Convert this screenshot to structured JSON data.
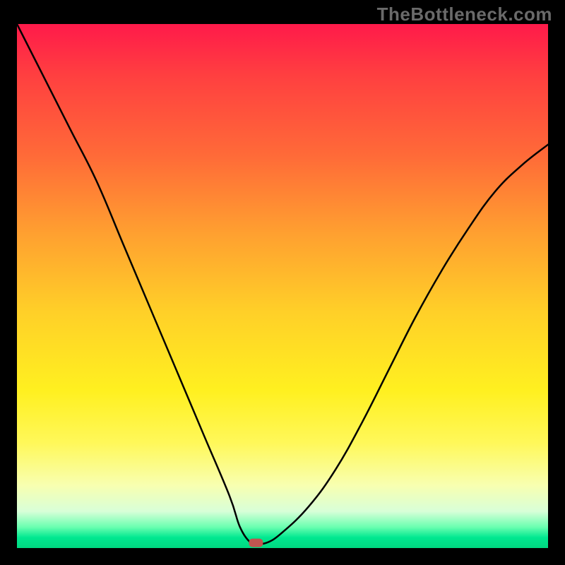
{
  "watermark": "TheBottleneck.com",
  "chart_data": {
    "type": "line",
    "title": "",
    "xlabel": "",
    "ylabel": "",
    "xlim": [
      0,
      100
    ],
    "ylim": [
      0,
      100
    ],
    "series": [
      {
        "name": "bottleneck-curve",
        "x": [
          0,
          5,
          10,
          15,
          20,
          25,
          30,
          35,
          40,
          42,
          44,
          45,
          47,
          50,
          55,
          60,
          65,
          70,
          75,
          80,
          85,
          90,
          95,
          100
        ],
        "y": [
          100,
          90,
          80,
          70,
          58,
          46,
          34,
          22,
          10,
          4,
          1,
          1,
          1,
          3,
          8,
          15,
          24,
          34,
          44,
          53,
          61,
          68,
          73,
          77
        ]
      }
    ],
    "annotations": [
      {
        "name": "optimum-marker",
        "x": 45,
        "y": 1
      }
    ],
    "background_gradient": {
      "direction": "vertical",
      "stops": [
        {
          "pos": 0.0,
          "color": "#ff1a4a"
        },
        {
          "pos": 0.25,
          "color": "#ff6a38"
        },
        {
          "pos": 0.55,
          "color": "#ffd028"
        },
        {
          "pos": 0.8,
          "color": "#fff85a"
        },
        {
          "pos": 0.95,
          "color": "#6affb0"
        },
        {
          "pos": 1.0,
          "color": "#00d880"
        }
      ]
    }
  }
}
